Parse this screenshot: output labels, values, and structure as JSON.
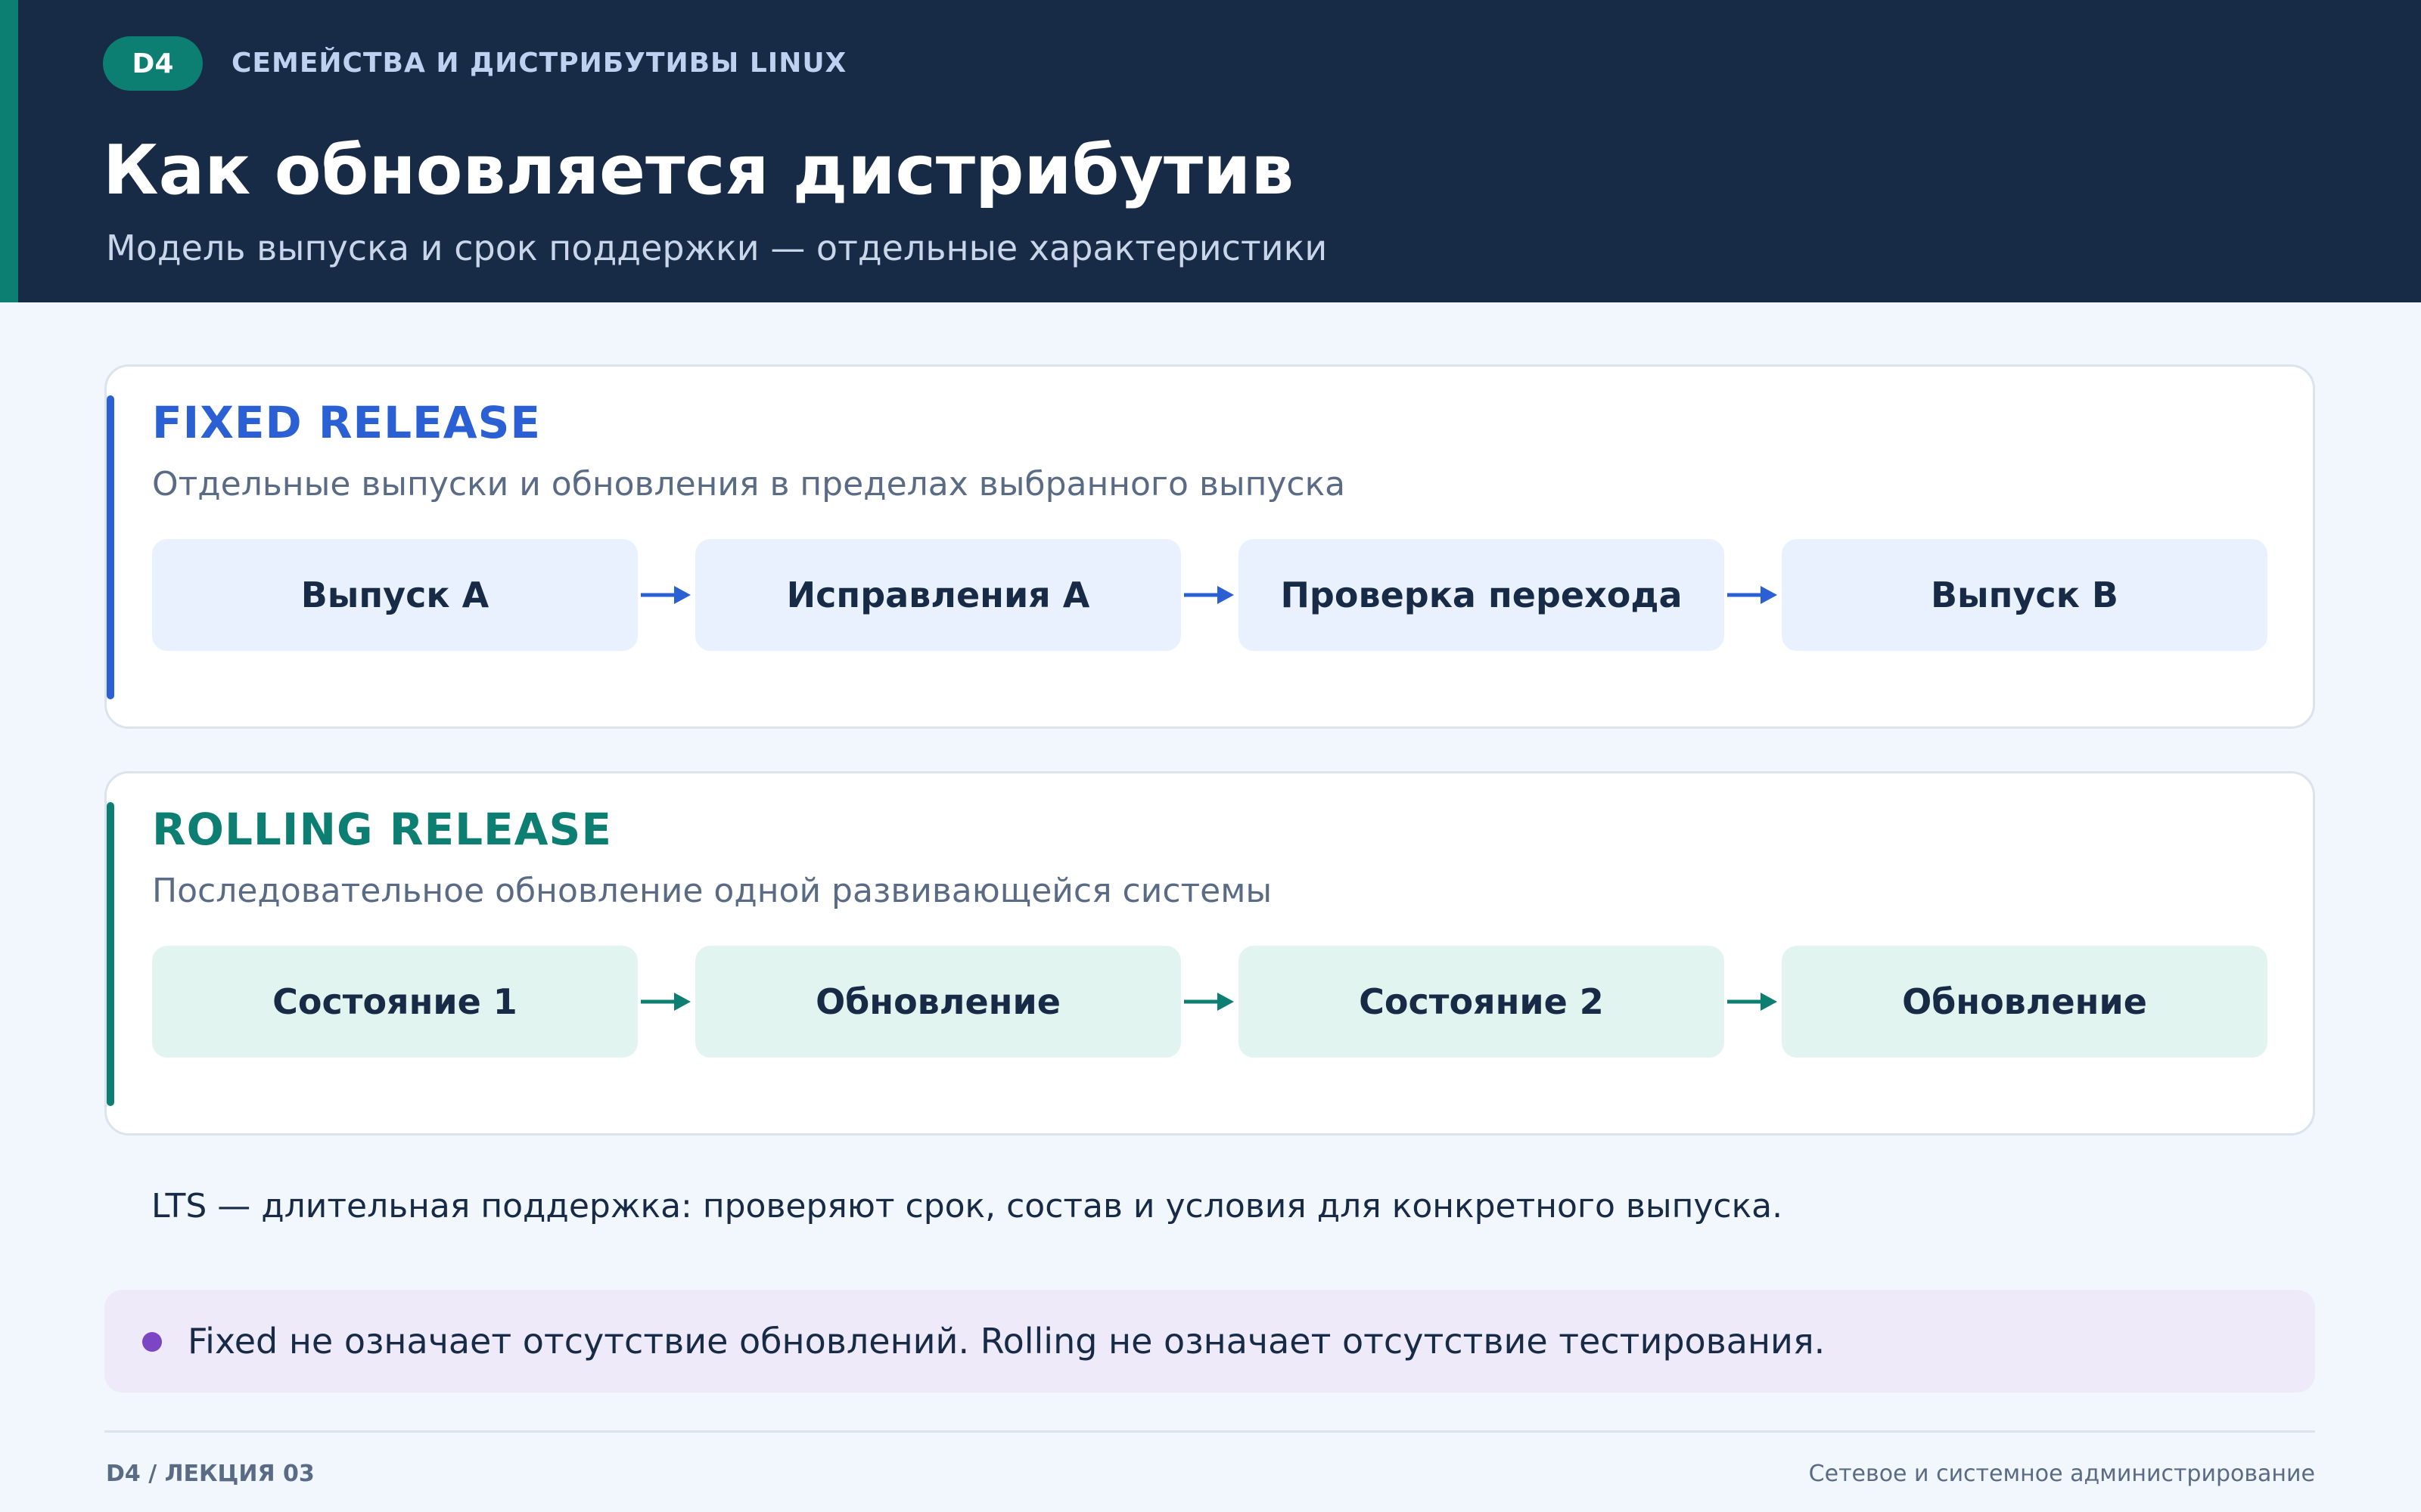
{
  "header": {
    "badge": "D4",
    "kicker": "СЕМЕЙСТВА И ДИСТРИБУТИВЫ LINUX",
    "title": "Как обновляется дистрибутив",
    "subtitle": "Модель выпуска и срок поддержки — отдельные характеристики"
  },
  "fixed": {
    "title": "FIXED RELEASE",
    "description": "Отдельные выпуски и обновления в пределах выбранного выпуска",
    "steps": [
      "Выпуск A",
      "Исправления A",
      "Проверка перехода",
      "Выпуск B"
    ],
    "color": "#2b5fd4"
  },
  "rolling": {
    "title": "ROLLING RELEASE",
    "description": "Последовательное обновление одной развивающейся системы",
    "steps": [
      "Состояние 1",
      "Обновление",
      "Состояние 2",
      "Обновление"
    ],
    "color": "#0d7e72"
  },
  "lts_note": "LTS — длительная поддержка: проверяют срок, состав и условия для конкретного выпуска.",
  "callout": {
    "text": "Fixed не означает отсутствие обновлений. Rolling не означает отсутствие тестирования.",
    "dot_color": "#7b45c4"
  },
  "footer": {
    "left": "D4 / ЛЕКЦИЯ 03",
    "right": "Сетевое и системное администрирование"
  }
}
